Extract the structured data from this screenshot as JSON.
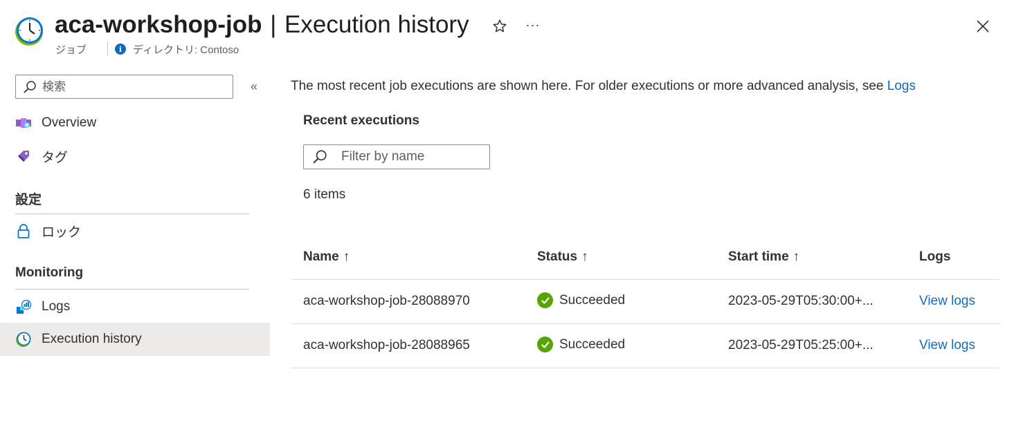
{
  "header": {
    "resource_name": "aca-workshop-job",
    "separator": "|",
    "page_name": "Execution history",
    "type_label": "ジョブ",
    "directory_label": "ディレクトリ: Contoso",
    "more_label": "···"
  },
  "sidebar": {
    "search_placeholder": "検索",
    "collapse_label": "«",
    "items": [
      {
        "label": "Overview",
        "icon": "overview-icon"
      },
      {
        "label": "タグ",
        "icon": "tag-icon"
      }
    ],
    "sections": [
      {
        "title": "設定",
        "items": [
          {
            "label": "ロック",
            "icon": "lock-icon"
          }
        ]
      },
      {
        "title": "Monitoring",
        "items": [
          {
            "label": "Logs",
            "icon": "logs-icon"
          },
          {
            "label": "Execution history",
            "icon": "clock-icon",
            "active": true
          }
        ]
      }
    ]
  },
  "main": {
    "intro_text": "The most recent job executions are shown here. For older executions or more advanced analysis, see ",
    "intro_link": "Logs",
    "recent_title": "Recent executions",
    "filter_placeholder": "Filter by name",
    "item_count": "6 items",
    "table": {
      "columns": [
        {
          "label": "Name",
          "sort": "↑"
        },
        {
          "label": "Status",
          "sort": "↑"
        },
        {
          "label": "Start time",
          "sort": "↑"
        },
        {
          "label": "Logs",
          "sort": ""
        }
      ],
      "rows": [
        {
          "name": "aca-workshop-job-28088970",
          "status": "Succeeded",
          "start_time": "2023-05-29T05:30:00+...",
          "logs": "View logs"
        },
        {
          "name": "aca-workshop-job-28088965",
          "status": "Succeeded",
          "start_time": "2023-05-29T05:25:00+...",
          "logs": "View logs"
        }
      ]
    }
  },
  "colors": {
    "accent": "#0f6cbd",
    "success": "#57a300",
    "active_bg": "#edebe9"
  }
}
